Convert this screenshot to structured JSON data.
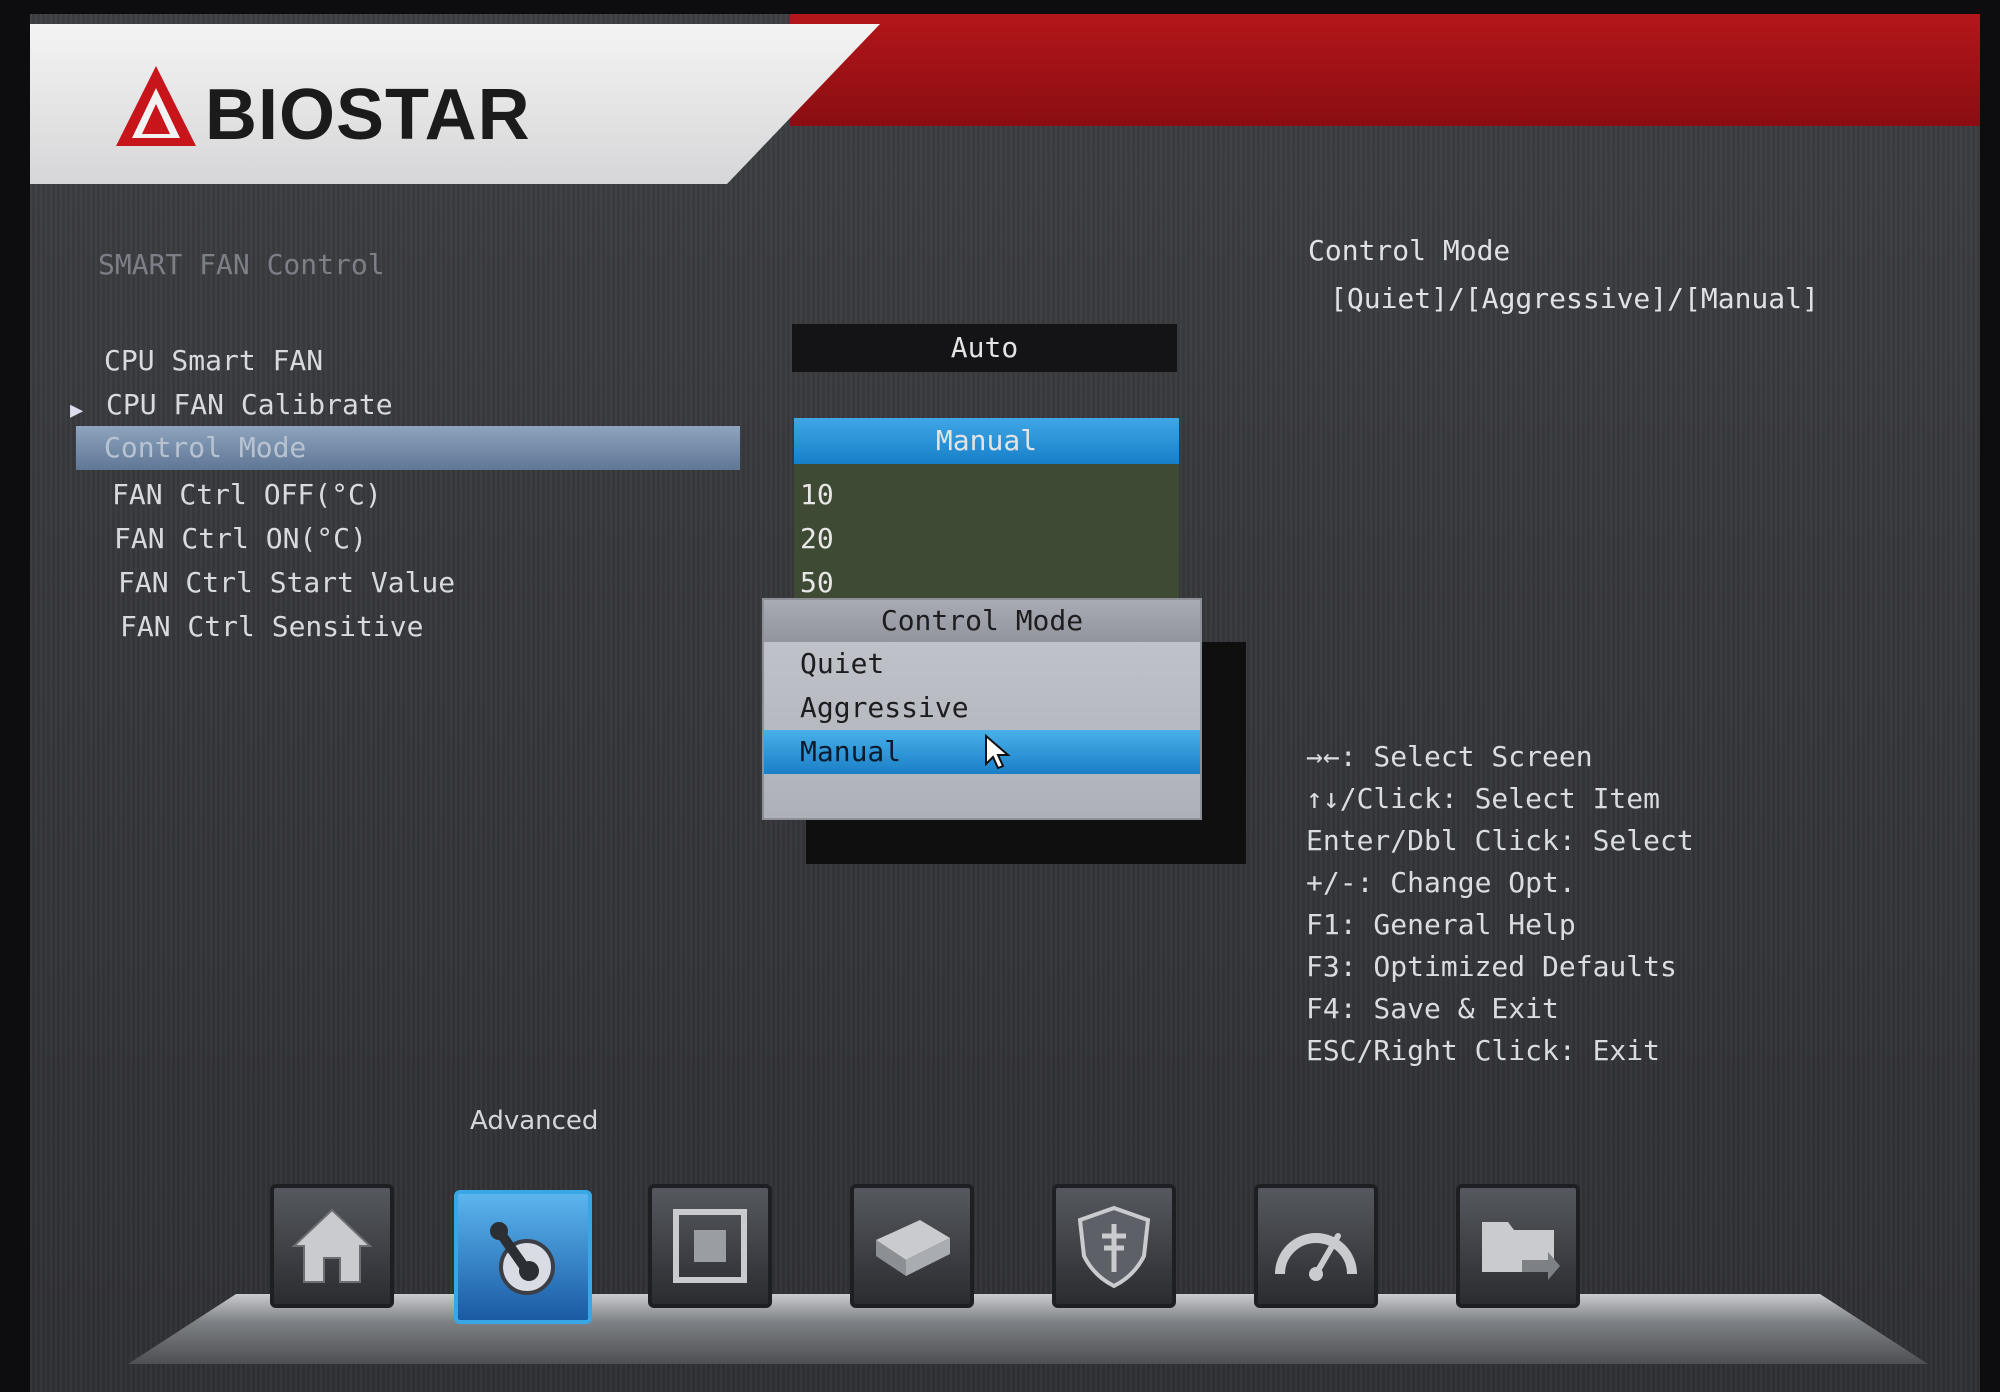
{
  "brand": {
    "name": "BIOSTAR"
  },
  "section": {
    "title": "SMART FAN Control"
  },
  "settings": [
    {
      "label": "CPU Smart FAN"
    },
    {
      "label": "CPU FAN Calibrate"
    },
    {
      "label": "Control Mode"
    },
    {
      "label": "FAN Ctrl OFF(°C)"
    },
    {
      "label": "FAN Ctrl ON(°C)"
    },
    {
      "label": "FAN Ctrl Start Value"
    },
    {
      "label": "FAN Ctrl Sensitive"
    }
  ],
  "values": {
    "cpu_smart_fan": "Auto",
    "control_mode": "Manual",
    "fan_ctrl_off": "10",
    "fan_ctrl_on": "20",
    "fan_ctrl_start": "50"
  },
  "popup": {
    "title": "Control Mode",
    "options": [
      "Quiet",
      "Aggressive",
      "Manual"
    ],
    "selected": "Manual"
  },
  "help": {
    "title": "Control Mode",
    "options": "[Quiet]/[Aggressive]/[Manual]"
  },
  "keys": [
    "→←: Select Screen",
    "↑↓/Click: Select Item",
    "Enter/Dbl Click: Select",
    "+/-: Change Opt.",
    "F1: General Help",
    "F3: Optimized Defaults",
    "F4: Save & Exit",
    "ESC/Right Click: Exit"
  ],
  "dock": {
    "active_label": "Advanced",
    "icons": [
      "home-icon",
      "advanced-joystick-icon",
      "chipset-icon",
      "storage-icon",
      "security-shield-icon",
      "performance-gauge-icon",
      "exit-folder-icon"
    ]
  },
  "colors": {
    "accent_blue": "#1a7fc6",
    "brand_red": "#b3161a"
  }
}
